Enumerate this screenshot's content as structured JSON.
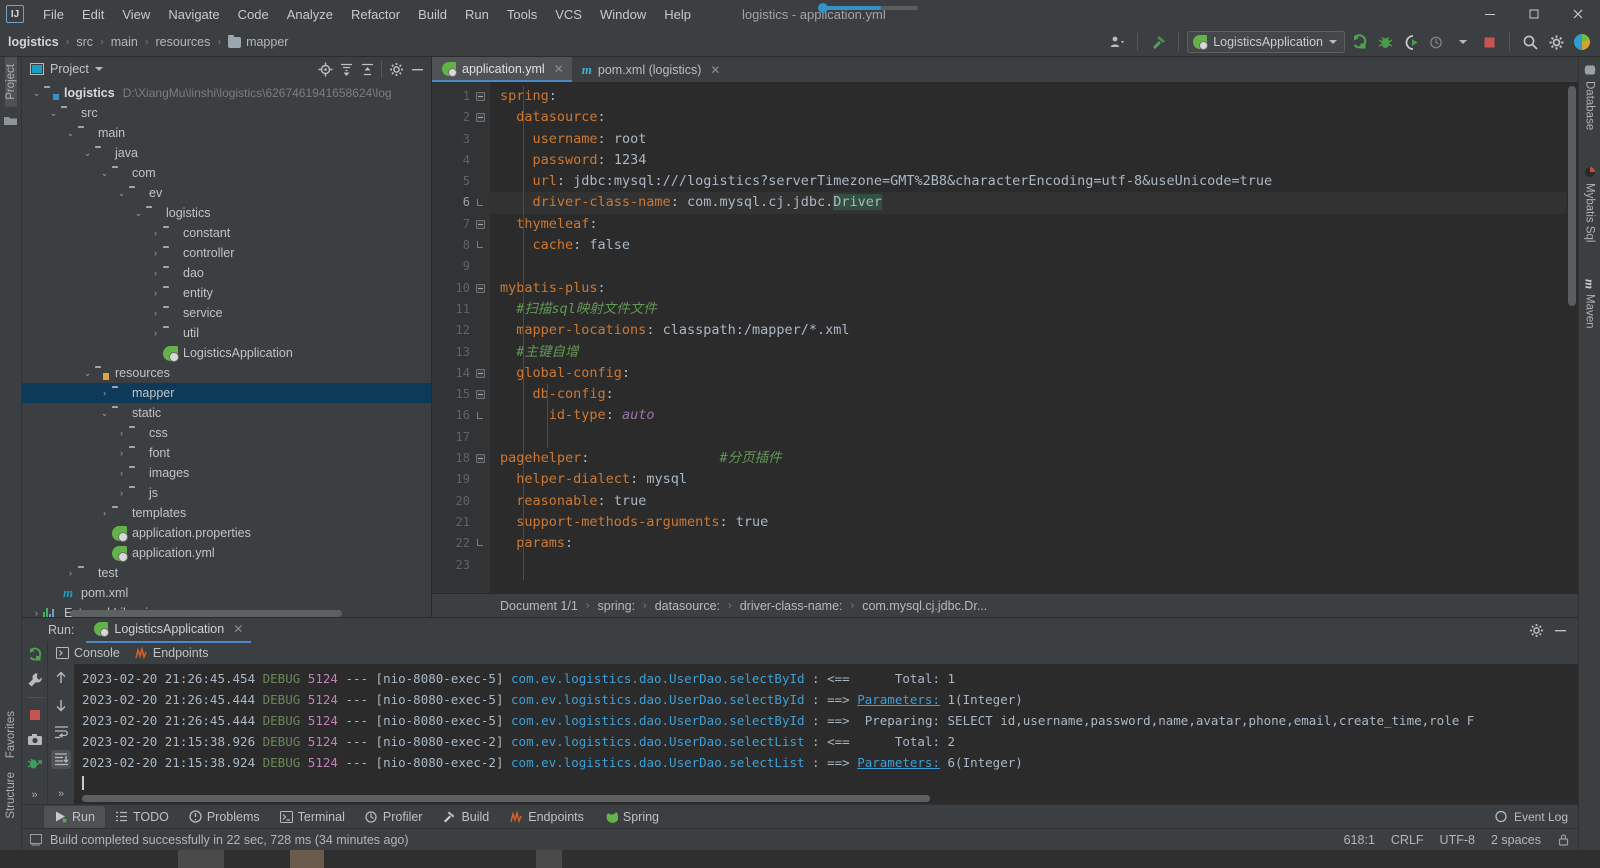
{
  "window": {
    "title": "logistics - application.yml",
    "minimize": "–",
    "maximize": "❐",
    "close": "✕"
  },
  "menu": {
    "logo": "IJ",
    "items": [
      "File",
      "Edit",
      "View",
      "Navigate",
      "Code",
      "Analyze",
      "Refactor",
      "Build",
      "Run",
      "Tools",
      "VCS",
      "Window",
      "Help"
    ]
  },
  "navbar": {
    "crumbs": [
      {
        "label": "logistics",
        "root": true,
        "folder": false
      },
      {
        "label": "src",
        "root": false,
        "folder": false
      },
      {
        "label": "main",
        "root": false,
        "folder": false
      },
      {
        "label": "resources",
        "root": false,
        "folder": false
      },
      {
        "label": "mapper",
        "root": false,
        "folder": true
      }
    ],
    "separator": "›",
    "run_config": "LogisticsApplication",
    "icons": {
      "user": "user-icon",
      "hammer": "build-hammer-icon",
      "run": "run-icon",
      "debug": "debug-icon",
      "coverage": "run-with-coverage-icon",
      "profiler": "profiler-icon",
      "stop": "stop-icon",
      "search": "search-icon",
      "settings": "settings-gear-icon",
      "updates": "updates-icon"
    }
  },
  "left_stripe": {
    "top": [
      "Project"
    ],
    "bottom": [
      "Structure",
      "Favorites"
    ]
  },
  "right_stripe": {
    "items": [
      "Database",
      "Mybatis Sql",
      "Maven"
    ]
  },
  "project_panel": {
    "title": "Project",
    "header_icons": [
      "locate-icon",
      "expand-all-icon",
      "collapse-all-icon",
      "settings-gear-icon",
      "hide-icon"
    ],
    "tree": [
      {
        "depth": 0,
        "arrow": "⌄",
        "icon": "module",
        "label": "logistics",
        "bold": true,
        "path": "D:\\XiangMu\\linshi\\logistics\\6267461941658624\\log",
        "selected": false
      },
      {
        "depth": 1,
        "arrow": "⌄",
        "icon": "folder",
        "label": "src",
        "bold": false,
        "path": "",
        "selected": false
      },
      {
        "depth": 2,
        "arrow": "⌄",
        "icon": "folder",
        "label": "main",
        "bold": false,
        "path": "",
        "selected": false
      },
      {
        "depth": 3,
        "arrow": "⌄",
        "icon": "source",
        "label": "java",
        "bold": false,
        "path": "",
        "selected": false
      },
      {
        "depth": 4,
        "arrow": "⌄",
        "icon": "package",
        "label": "com",
        "bold": false,
        "path": "",
        "selected": false
      },
      {
        "depth": 5,
        "arrow": "⌄",
        "icon": "package",
        "label": "ev",
        "bold": false,
        "path": "",
        "selected": false
      },
      {
        "depth": 6,
        "arrow": "⌄",
        "icon": "package",
        "label": "logistics",
        "bold": false,
        "path": "",
        "selected": false
      },
      {
        "depth": 7,
        "arrow": "›",
        "icon": "package",
        "label": "constant",
        "bold": false,
        "path": "",
        "selected": false
      },
      {
        "depth": 7,
        "arrow": "›",
        "icon": "package",
        "label": "controller",
        "bold": false,
        "path": "",
        "selected": false
      },
      {
        "depth": 7,
        "arrow": "›",
        "icon": "package",
        "label": "dao",
        "bold": false,
        "path": "",
        "selected": false
      },
      {
        "depth": 7,
        "arrow": "›",
        "icon": "package",
        "label": "entity",
        "bold": false,
        "path": "",
        "selected": false
      },
      {
        "depth": 7,
        "arrow": "›",
        "icon": "package",
        "label": "service",
        "bold": false,
        "path": "",
        "selected": false
      },
      {
        "depth": 7,
        "arrow": "›",
        "icon": "package",
        "label": "util",
        "bold": false,
        "path": "",
        "selected": false
      },
      {
        "depth": 7,
        "arrow": "",
        "icon": "spring",
        "label": "LogisticsApplication",
        "bold": false,
        "path": "",
        "selected": false
      },
      {
        "depth": 3,
        "arrow": "⌄",
        "icon": "resources",
        "label": "resources",
        "bold": false,
        "path": "",
        "selected": false
      },
      {
        "depth": 4,
        "arrow": "›",
        "icon": "folder",
        "label": "mapper",
        "bold": false,
        "path": "",
        "selected": true
      },
      {
        "depth": 4,
        "arrow": "⌄",
        "icon": "folder",
        "label": "static",
        "bold": false,
        "path": "",
        "selected": false
      },
      {
        "depth": 5,
        "arrow": "›",
        "icon": "folder",
        "label": "css",
        "bold": false,
        "path": "",
        "selected": false
      },
      {
        "depth": 5,
        "arrow": "›",
        "icon": "folder",
        "label": "font",
        "bold": false,
        "path": "",
        "selected": false
      },
      {
        "depth": 5,
        "arrow": "›",
        "icon": "folder",
        "label": "images",
        "bold": false,
        "path": "",
        "selected": false
      },
      {
        "depth": 5,
        "arrow": "›",
        "icon": "folder",
        "label": "js",
        "bold": false,
        "path": "",
        "selected": false
      },
      {
        "depth": 4,
        "arrow": "›",
        "icon": "folder",
        "label": "templates",
        "bold": false,
        "path": "",
        "selected": false
      },
      {
        "depth": 4,
        "arrow": "",
        "icon": "spring",
        "label": "application.properties",
        "bold": false,
        "path": "",
        "selected": false
      },
      {
        "depth": 4,
        "arrow": "",
        "icon": "spring",
        "label": "application.yml",
        "bold": false,
        "path": "",
        "selected": false
      },
      {
        "depth": 2,
        "arrow": "›",
        "icon": "folder",
        "label": "test",
        "bold": false,
        "path": "",
        "selected": false
      },
      {
        "depth": 1,
        "arrow": "",
        "icon": "maven",
        "label": "pom.xml",
        "bold": false,
        "path": "",
        "selected": false
      },
      {
        "depth": 0,
        "arrow": "›",
        "icon": "library",
        "label": "External Libraries",
        "bold": false,
        "path": "",
        "selected": false
      }
    ]
  },
  "editor": {
    "tabs": [
      {
        "label": "application.yml",
        "icon": "spring-icon",
        "active": true,
        "close": "✕"
      },
      {
        "label": "pom.xml (logistics)",
        "icon": "maven-icon",
        "active": false,
        "close": "✕"
      }
    ],
    "lines": [
      {
        "n": 1,
        "fold": "start",
        "text": "spring:",
        "cur": false
      },
      {
        "n": 2,
        "fold": "start",
        "text": "  datasource:",
        "cur": false
      },
      {
        "n": 3,
        "fold": "",
        "text": "    username: root",
        "cur": false
      },
      {
        "n": 4,
        "fold": "",
        "text": "    password: 1234",
        "cur": false
      },
      {
        "n": 5,
        "fold": "",
        "text": "    url: jdbc:mysql:///logistics?serverTimezone=GMT%2B8&characterEncoding=utf-8&useUnicode=true",
        "cur": false
      },
      {
        "n": 6,
        "fold": "end",
        "text": "    driver-class-name: com.mysql.cj.jdbc.Driver",
        "cur": true
      },
      {
        "n": 7,
        "fold": "start",
        "text": "  thymeleaf:",
        "cur": false
      },
      {
        "n": 8,
        "fold": "end",
        "text": "    cache: false",
        "cur": false
      },
      {
        "n": 9,
        "fold": "",
        "text": "",
        "cur": false
      },
      {
        "n": 10,
        "fold": "start",
        "text": "mybatis-plus:",
        "cur": false
      },
      {
        "n": 11,
        "fold": "",
        "text": "  #扫描sql映射文件文件",
        "cur": false
      },
      {
        "n": 12,
        "fold": "",
        "text": "  mapper-locations: classpath:/mapper/*.xml",
        "cur": false
      },
      {
        "n": 13,
        "fold": "",
        "text": "  #主键自增",
        "cur": false
      },
      {
        "n": 14,
        "fold": "start",
        "text": "  global-config:",
        "cur": false
      },
      {
        "n": 15,
        "fold": "start",
        "text": "    db-config:",
        "cur": false
      },
      {
        "n": 16,
        "fold": "end",
        "text": "      id-type: auto",
        "cur": false
      },
      {
        "n": 17,
        "fold": "",
        "text": "",
        "cur": false
      },
      {
        "n": 18,
        "fold": "start",
        "text": "pagehelper:                #分页插件",
        "cur": false
      },
      {
        "n": 19,
        "fold": "",
        "text": "  helper-dialect: mysql",
        "cur": false
      },
      {
        "n": 20,
        "fold": "",
        "text": "  reasonable: true",
        "cur": false
      },
      {
        "n": 21,
        "fold": "",
        "text": "  support-methods-arguments: true",
        "cur": false
      },
      {
        "n": 22,
        "fold": "end",
        "text": "  params:",
        "cur": false
      },
      {
        "n": 23,
        "fold": "",
        "text": "",
        "cur": false
      }
    ],
    "breadcrumbs": [
      "Document 1/1",
      "spring:",
      "datasource:",
      "driver-class-name:",
      "com.mysql.cj.jdbc.Dr..."
    ],
    "breadcrumb_sep": "›"
  },
  "run_panel": {
    "label": "Run:",
    "tab": "LogisticsApplication",
    "tab_close": "✕",
    "console_tabs": [
      {
        "label": "Console",
        "icon": "console-icon"
      },
      {
        "label": "Endpoints",
        "icon": "endpoints-icon"
      }
    ],
    "side_icons": [
      "rerun-icon",
      "wrench-icon",
      "stop-icon",
      "camera-icon",
      "export-thread-icon"
    ],
    "side2_icons": [
      "up-arrow-icon",
      "down-arrow-icon",
      "soft-wrap-icon",
      "scroll-to-end-icon"
    ],
    "header_icons": [
      "settings-gear-icon",
      "hide-icon"
    ],
    "log": [
      {
        "date": "2023-02-20 21:15:38.924",
        "level": "DEBUG",
        "pid": "5124",
        "sep": "---",
        "thread": "[nio-8080-exec-2]",
        "cls": "com.ev.logistics.dao.UserDao.selectList",
        "arrow": " : ==> ",
        "param_label": "Parameters:",
        "msg": " 6(Integer)"
      },
      {
        "date": "2023-02-20 21:15:38.926",
        "level": "DEBUG",
        "pid": "5124",
        "sep": "---",
        "thread": "[nio-8080-exec-2]",
        "cls": "com.ev.logistics.dao.UserDao.selectList",
        "arrow": " : <==      ",
        "param_label": "",
        "msg": "Total: 2"
      },
      {
        "date": "2023-02-20 21:26:45.444",
        "level": "DEBUG",
        "pid": "5124",
        "sep": "---",
        "thread": "[nio-8080-exec-5]",
        "cls": "com.ev.logistics.dao.UserDao.selectById",
        "arrow": " : ==>  ",
        "param_label": "",
        "msg": "Preparing: SELECT id,username,password,name,avatar,phone,email,create_time,role F"
      },
      {
        "date": "2023-02-20 21:26:45.444",
        "level": "DEBUG",
        "pid": "5124",
        "sep": "---",
        "thread": "[nio-8080-exec-5]",
        "cls": "com.ev.logistics.dao.UserDao.selectById",
        "arrow": " : ==> ",
        "param_label": "Parameters:",
        "msg": " 1(Integer)"
      },
      {
        "date": "2023-02-20 21:26:45.454",
        "level": "DEBUG",
        "pid": "5124",
        "sep": "---",
        "thread": "[nio-8080-exec-5]",
        "cls": "com.ev.logistics.dao.UserDao.selectById",
        "arrow": " : <==      ",
        "param_label": "",
        "msg": "Total: 1"
      }
    ]
  },
  "bottom_toolbar": {
    "items": [
      {
        "label": "Run",
        "icon": "run-icon",
        "active": true
      },
      {
        "label": "TODO",
        "icon": "todo-icon",
        "active": false
      },
      {
        "label": "Problems",
        "icon": "problems-icon",
        "active": false
      },
      {
        "label": "Terminal",
        "icon": "terminal-icon",
        "active": false
      },
      {
        "label": "Profiler",
        "icon": "profiler-icon",
        "active": false
      },
      {
        "label": "Build",
        "icon": "build-hammer-icon",
        "active": false
      },
      {
        "label": "Endpoints",
        "icon": "endpoints-icon",
        "active": false
      },
      {
        "label": "Spring",
        "icon": "spring-icon",
        "active": false
      }
    ],
    "event_log": "Event Log"
  },
  "statusbar": {
    "message": "Build completed successfully in 22 sec, 728 ms (34 minutes ago)",
    "caret": "618:1",
    "line_sep": "CRLF",
    "encoding": "UTF-8",
    "indent": "2 spaces",
    "lock_icon": "lock-icon"
  },
  "colors": {
    "accent_blue": "#4a88c7",
    "selection": "#0d3a58",
    "keyword_orange": "#cc7832",
    "value_gray": "#a9b7c6",
    "comment_green": "#629755",
    "debug_green": "#6a8759",
    "pid_purple": "#c77dbb",
    "class_blue": "#3d9fd6",
    "spring_green": "#63b34a",
    "stop_red": "#c75450"
  }
}
